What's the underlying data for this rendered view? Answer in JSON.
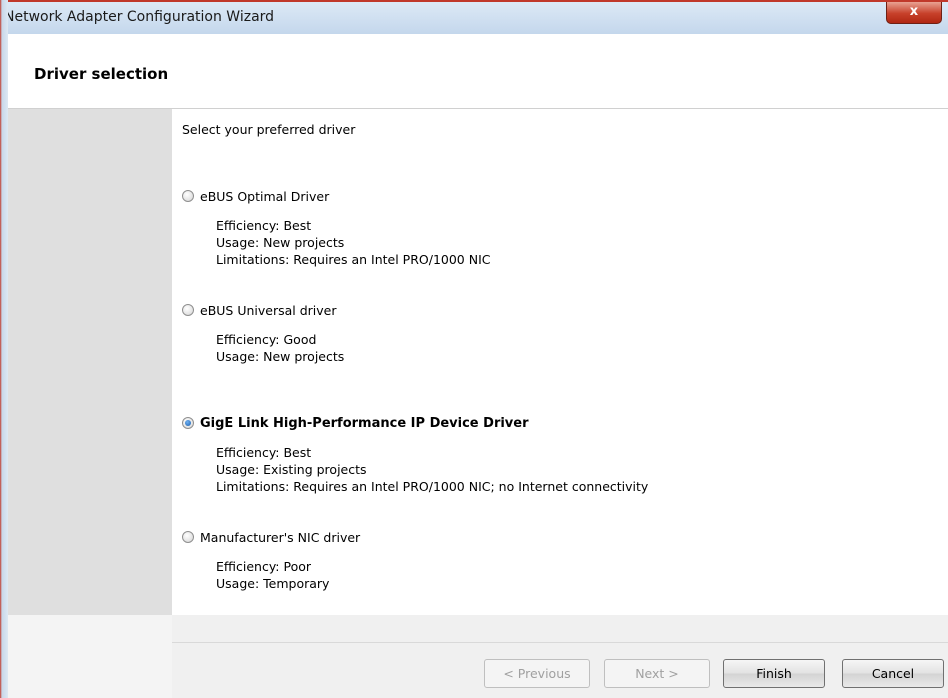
{
  "window": {
    "title": "Network Adapter Configuration Wizard",
    "close_glyph": "x"
  },
  "header": {
    "title": "Driver selection"
  },
  "main": {
    "prompt": "Select your preferred driver",
    "options": [
      {
        "label": "eBUS Optimal Driver",
        "selected": false,
        "details": [
          "Efficiency: Best",
          "Usage: New projects",
          "Limitations: Requires an Intel PRO/1000 NIC"
        ]
      },
      {
        "label": "eBUS Universal driver",
        "selected": false,
        "details": [
          "Efficiency: Good",
          "Usage: New projects"
        ]
      },
      {
        "label": "GigE Link High-Performance IP Device Driver",
        "selected": true,
        "details": [
          "Efficiency: Best",
          "Usage: Existing projects",
          "Limitations: Requires an Intel PRO/1000 NIC; no Internet connectivity"
        ]
      },
      {
        "label": "Manufacturer's NIC driver",
        "selected": false,
        "details": [
          "Efficiency: Poor",
          "Usage: Temporary"
        ]
      }
    ]
  },
  "footer": {
    "previous_label": "< Previous",
    "next_label": "Next >",
    "finish_label": "Finish",
    "cancel_label": "Cancel"
  },
  "colors": {
    "close_button": "#c7402a",
    "side_panel": "#dfdfdf",
    "radio_selected": "#1a5fb0"
  }
}
